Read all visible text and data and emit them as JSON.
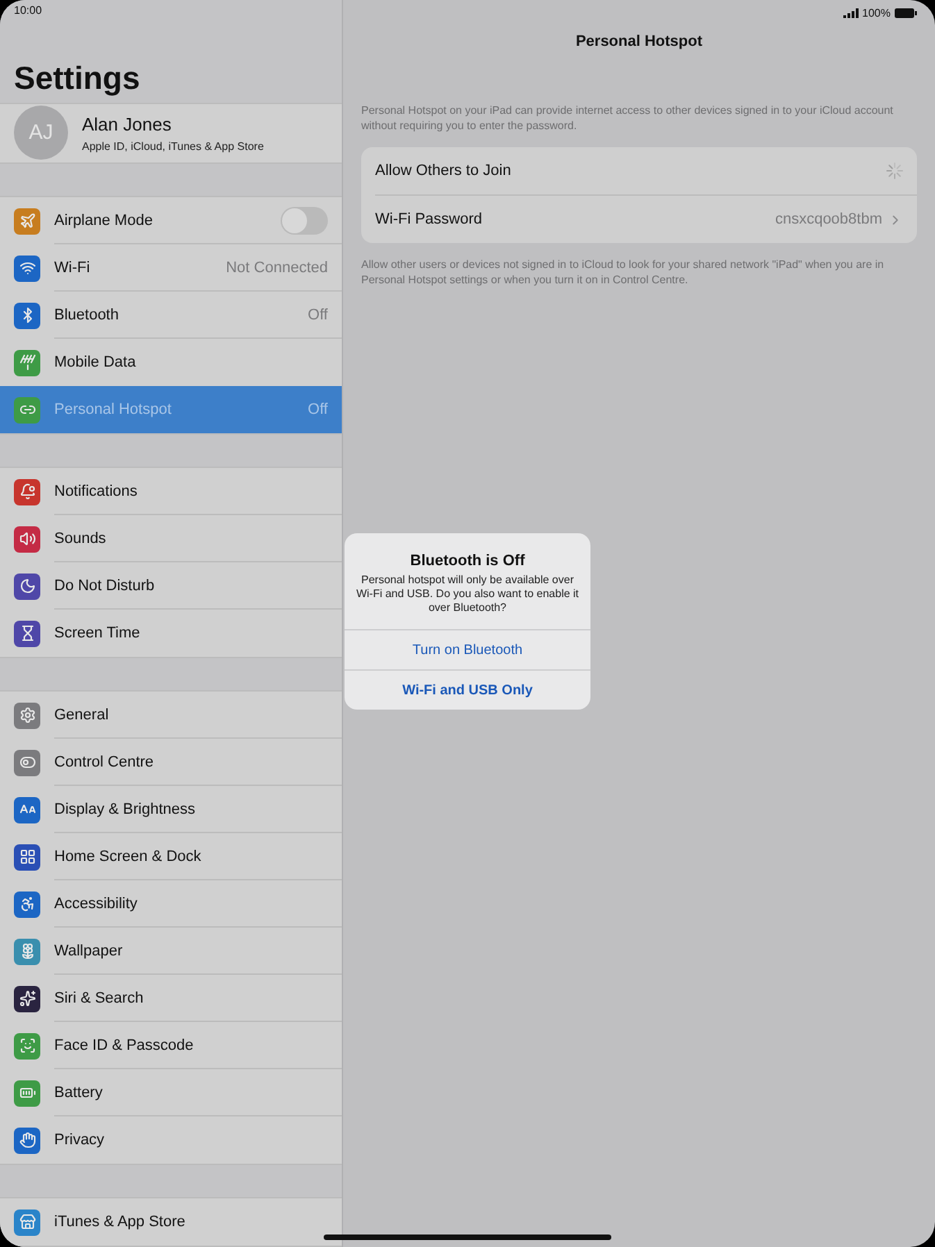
{
  "status_bar": {
    "time": "10:00",
    "battery": "100%"
  },
  "sidebar": {
    "title": "Settings",
    "profile": {
      "initials": "AJ",
      "name": "Alan Jones",
      "subtitle": "Apple ID, iCloud, iTunes & App Store"
    },
    "groups": [
      {
        "items": [
          {
            "label": "Airplane Mode",
            "color": "#c77d1f",
            "kind": "toggle",
            "on": false,
            "selected": false
          },
          {
            "label": "Wi-Fi",
            "color": "#1c66c4",
            "kind": "value",
            "value": "Not Connected",
            "selected": false
          },
          {
            "label": "Bluetooth",
            "color": "#1c66c4",
            "kind": "value",
            "value": "Off",
            "selected": false
          },
          {
            "label": "Mobile Data",
            "color": "#3e9b46",
            "kind": "plain",
            "selected": false
          },
          {
            "label": "Personal Hotspot",
            "color": "#3e9b46",
            "kind": "value",
            "value": "Off",
            "selected": true
          }
        ]
      },
      {
        "items": [
          {
            "label": "Notifications",
            "color": "#c7352d",
            "kind": "plain",
            "selected": false
          },
          {
            "label": "Sounds",
            "color": "#c42b45",
            "kind": "plain",
            "selected": false
          },
          {
            "label": "Do Not Disturb",
            "color": "#4f47a8",
            "kind": "plain",
            "selected": false
          },
          {
            "label": "Screen Time",
            "color": "#4f47a8",
            "kind": "plain",
            "selected": false
          }
        ]
      },
      {
        "items": [
          {
            "label": "General",
            "color": "#7b7b7e",
            "kind": "plain",
            "selected": false
          },
          {
            "label": "Control Centre",
            "color": "#7b7b7e",
            "kind": "plain",
            "selected": false
          },
          {
            "label": "Display & Brightness",
            "color": "#1c66c4",
            "kind": "plain",
            "selected": false
          },
          {
            "label": "Home Screen & Dock",
            "color": "#2a4fb5",
            "kind": "plain",
            "selected": false
          },
          {
            "label": "Accessibility",
            "color": "#1c66c4",
            "kind": "plain",
            "selected": false
          },
          {
            "label": "Wallpaper",
            "color": "#3a8fae",
            "kind": "plain",
            "selected": false
          },
          {
            "label": "Siri & Search",
            "color": "#2a2440",
            "kind": "plain",
            "selected": false
          },
          {
            "label": "Face ID & Passcode",
            "color": "#3e9b46",
            "kind": "plain",
            "selected": false
          },
          {
            "label": "Battery",
            "color": "#3e9b46",
            "kind": "plain",
            "selected": false
          },
          {
            "label": "Privacy",
            "color": "#1c66c4",
            "kind": "plain",
            "selected": false
          }
        ]
      },
      {
        "items": [
          {
            "label": "iTunes & App Store",
            "color": "#2a84c9",
            "kind": "plain",
            "selected": false
          }
        ]
      }
    ]
  },
  "detail": {
    "title": "Personal Hotspot",
    "intro": "Personal Hotspot on your iPad can provide internet access to other devices signed in to your iCloud account without requiring you to enter the password.",
    "rows": [
      {
        "label": "Allow Others to Join",
        "kind": "loading"
      },
      {
        "label": "Wi-Fi Password",
        "kind": "link",
        "value": "cnsxcqoob8tbm"
      }
    ],
    "footer": "Allow other users or devices not signed in to iCloud to look for your shared network \"iPad\" when you are in Personal Hotspot settings or when you turn it on in Control Centre."
  },
  "alert": {
    "title": "Bluetooth is Off",
    "message": "Personal hotspot will only be available over Wi-Fi and USB. Do you also want to enable it over Bluetooth?",
    "buttons": [
      {
        "label": "Turn on Bluetooth",
        "kind": "normal"
      },
      {
        "label": "Wi-Fi and USB Only",
        "kind": "preferred"
      }
    ]
  }
}
